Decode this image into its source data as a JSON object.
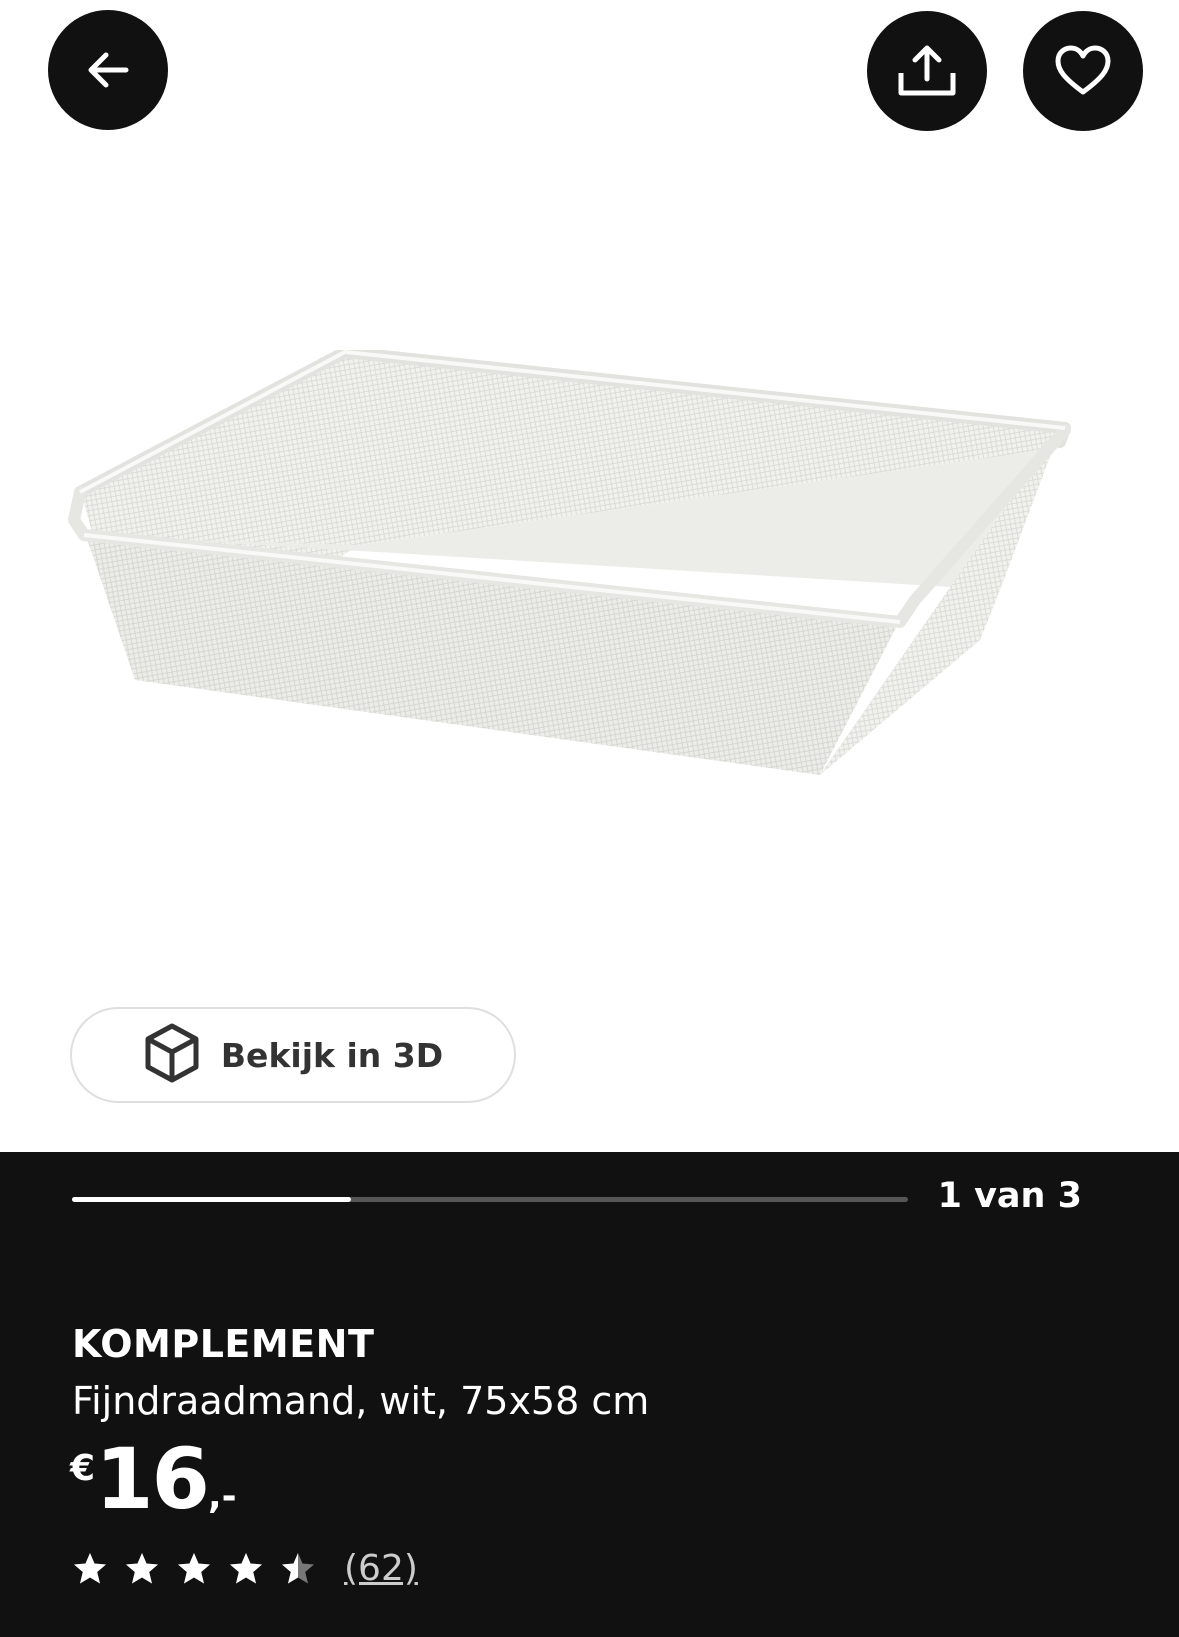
{
  "header": {
    "back_icon": "arrow-left-icon",
    "share_icon": "share-upload-icon",
    "favorite_icon": "heart-icon"
  },
  "gallery": {
    "view_3d_label": "Bekijk in 3D",
    "view_3d_icon": "cube-3d-icon",
    "current_page": 1,
    "total_pages": 3,
    "page_counter": "1 van 3"
  },
  "product": {
    "name": "KOMPLEMENT",
    "description": "Fijndraadmand, wit, 75x58 cm",
    "price_currency": "€",
    "price_amount": "16",
    "price_suffix": ",-",
    "rating": 4.5,
    "rating_max": 5,
    "review_count": "(62)"
  },
  "colors": {
    "panel_bg": "#111111",
    "button_bg": "#111111",
    "text_light": "#ffffff",
    "progress_track": "#555555",
    "progress_fill": "#ffffff"
  }
}
